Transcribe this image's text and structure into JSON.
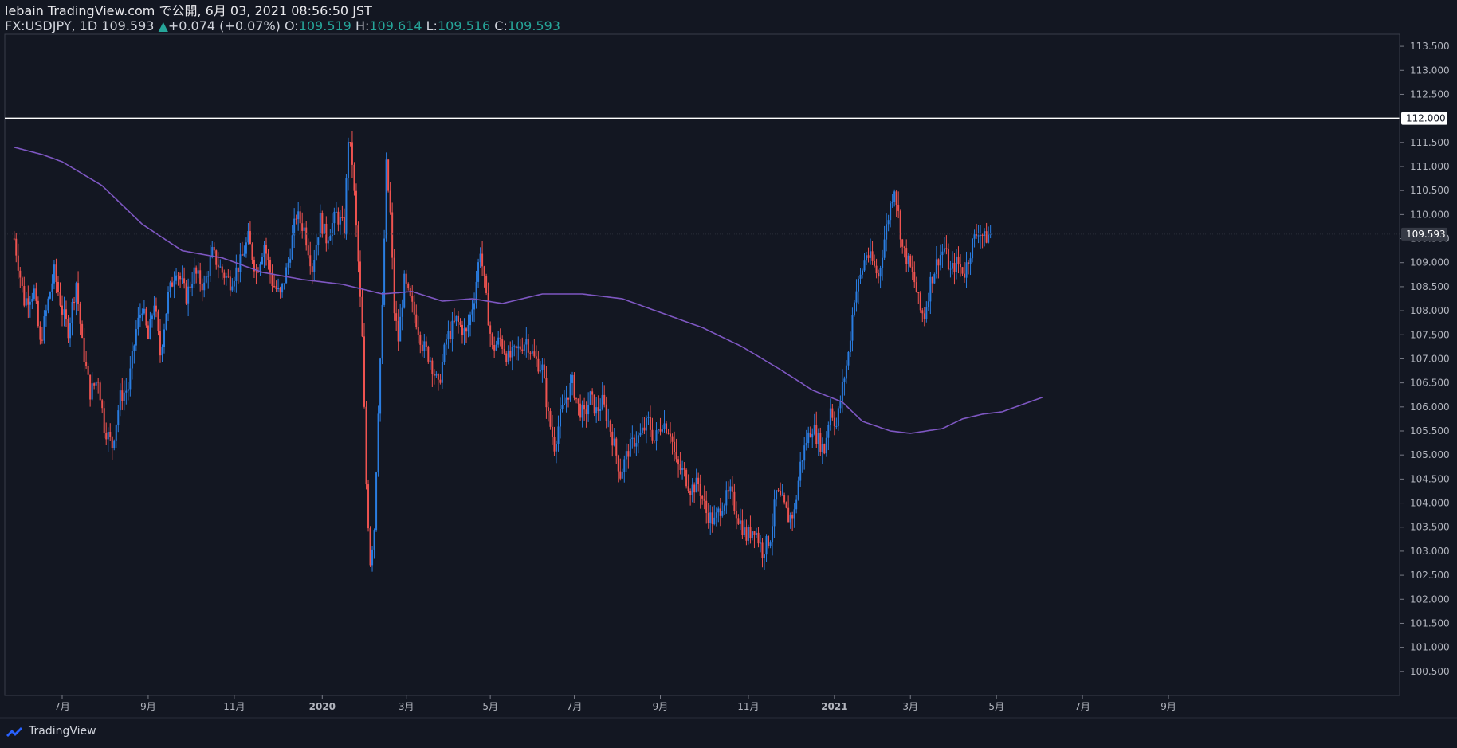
{
  "header": {
    "published_line": "lebain TradingView.com で公開, 6月 03, 2021 08:56:50 JST",
    "symbol": "FX:USDJPY, 1D",
    "last": "109.593",
    "change_arrow": "▲",
    "change": "+0.074 (+0.07%)",
    "o_label": "O:",
    "o_value": "109.519",
    "h_label": "H:",
    "h_value": "109.614",
    "l_label": "L:",
    "l_value": "109.516",
    "c_label": "C:",
    "c_value": "109.593"
  },
  "footer": {
    "brand": "TradingView"
  },
  "colors": {
    "background": "#131722",
    "up": "#2a7de1",
    "down": "#ef5350",
    "ma": "#7e57c2",
    "level": "#ffffff",
    "text": "#d1d4dc"
  },
  "chart_data": {
    "type": "candlestick",
    "ylim": [
      100.0,
      113.75
    ],
    "y_ticks": [
      "100.500",
      "101.000",
      "101.500",
      "102.000",
      "102.500",
      "103.000",
      "103.500",
      "104.000",
      "104.500",
      "105.000",
      "105.500",
      "106.000",
      "106.500",
      "107.000",
      "107.500",
      "108.000",
      "108.500",
      "109.000",
      "109.500",
      "110.000",
      "110.500",
      "111.000",
      "111.500",
      "112.000",
      "112.500",
      "113.000",
      "113.500"
    ],
    "x_ticks": [
      {
        "label": "7月",
        "i": 0
      },
      {
        "label": "9月",
        "i": 43
      },
      {
        "label": "11月",
        "i": 86
      },
      {
        "label": "2020",
        "i": 130
      },
      {
        "label": "3月",
        "i": 172
      },
      {
        "label": "5月",
        "i": 214
      },
      {
        "label": "7月",
        "i": 256
      },
      {
        "label": "9月",
        "i": 299
      },
      {
        "label": "11月",
        "i": 343
      },
      {
        "label": "2021",
        "i": 386
      },
      {
        "label": "3月",
        "i": 424
      },
      {
        "label": "5月",
        "i": 467
      },
      {
        "label": "7月",
        "i": 510
      },
      {
        "label": "9月",
        "i": 553
      }
    ],
    "horizontal_level": {
      "value": 112.0,
      "label": "112.000"
    },
    "last_price": {
      "value": 109.593,
      "label": "109.593"
    },
    "moving_average_anchors": [
      [
        -24,
        111.4
      ],
      [
        -10,
        111.25
      ],
      [
        0,
        111.1
      ],
      [
        20,
        110.6
      ],
      [
        40,
        109.8
      ],
      [
        60,
        109.25
      ],
      [
        80,
        109.1
      ],
      [
        100,
        108.8
      ],
      [
        120,
        108.65
      ],
      [
        140,
        108.55
      ],
      [
        160,
        108.35
      ],
      [
        175,
        108.4
      ],
      [
        190,
        108.2
      ],
      [
        205,
        108.25
      ],
      [
        220,
        108.15
      ],
      [
        240,
        108.35
      ],
      [
        260,
        108.35
      ],
      [
        280,
        108.25
      ],
      [
        300,
        107.95
      ],
      [
        320,
        107.65
      ],
      [
        340,
        107.25
      ],
      [
        360,
        106.75
      ],
      [
        375,
        106.35
      ],
      [
        390,
        106.1
      ],
      [
        400,
        105.7
      ],
      [
        414,
        105.5
      ],
      [
        424,
        105.45
      ],
      [
        440,
        105.55
      ],
      [
        450,
        105.75
      ],
      [
        460,
        105.85
      ],
      [
        470,
        105.9
      ],
      [
        480,
        106.05
      ],
      [
        490,
        106.2
      ]
    ],
    "close_anchors": [
      [
        -24,
        109.5
      ],
      [
        -19,
        108.2
      ],
      [
        -14,
        108.4
      ],
      [
        -11,
        107.3
      ],
      [
        -7,
        108.2
      ],
      [
        -4,
        108.8
      ],
      [
        0,
        108.0
      ],
      [
        3,
        107.6
      ],
      [
        7,
        108.6
      ],
      [
        10,
        107.3
      ],
      [
        14,
        106.3
      ],
      [
        18,
        106.6
      ],
      [
        21,
        105.6
      ],
      [
        25,
        105.2
      ],
      [
        29,
        106.2
      ],
      [
        33,
        106.4
      ],
      [
        37,
        107.6
      ],
      [
        40,
        108.1
      ],
      [
        43,
        107.4
      ],
      [
        46,
        108.2
      ],
      [
        49,
        107.1
      ],
      [
        53,
        108.3
      ],
      [
        57,
        108.9
      ],
      [
        62,
        108.3
      ],
      [
        66,
        108.8
      ],
      [
        71,
        108.5
      ],
      [
        75,
        109.2
      ],
      [
        80,
        108.8
      ],
      [
        84,
        108.6
      ],
      [
        89,
        109.0
      ],
      [
        93,
        109.5
      ],
      [
        97,
        108.8
      ],
      [
        101,
        109.4
      ],
      [
        105,
        108.6
      ],
      [
        109,
        108.3
      ],
      [
        113,
        109.0
      ],
      [
        117,
        110.0
      ],
      [
        121,
        109.7
      ],
      [
        125,
        108.9
      ],
      [
        129,
        109.9
      ],
      [
        132,
        109.5
      ],
      [
        137,
        110.0
      ],
      [
        141,
        109.7
      ],
      [
        143,
        111.6
      ],
      [
        145,
        111.1
      ],
      [
        148,
        109.0
      ],
      [
        150,
        107.4
      ],
      [
        152,
        104.4
      ],
      [
        154,
        102.8
      ],
      [
        156,
        103.5
      ],
      [
        158,
        106.0
      ],
      [
        160,
        108.0
      ],
      [
        162,
        111.0
      ],
      [
        164,
        110.0
      ],
      [
        166,
        108.0
      ],
      [
        168,
        107.4
      ],
      [
        171,
        108.6
      ],
      [
        174,
        108.2
      ],
      [
        177,
        107.8
      ],
      [
        180,
        107.3
      ],
      [
        184,
        107.0
      ],
      [
        188,
        106.4
      ],
      [
        192,
        107.4
      ],
      [
        197,
        107.8
      ],
      [
        202,
        107.5
      ],
      [
        206,
        108.3
      ],
      [
        209,
        109.3
      ],
      [
        212,
        108.2
      ],
      [
        215,
        107.2
      ],
      [
        219,
        107.4
      ],
      [
        223,
        107.0
      ],
      [
        228,
        107.2
      ],
      [
        232,
        107.4
      ],
      [
        236,
        107.0
      ],
      [
        240,
        106.8
      ],
      [
        243,
        105.8
      ],
      [
        246,
        105.2
      ],
      [
        249,
        105.8
      ],
      [
        252,
        106.2
      ],
      [
        255,
        106.5
      ],
      [
        258,
        106.0
      ],
      [
        261,
        105.8
      ],
      [
        264,
        106.2
      ],
      [
        267,
        105.9
      ],
      [
        270,
        106.1
      ],
      [
        273,
        105.7
      ],
      [
        276,
        105.2
      ],
      [
        279,
        104.6
      ],
      [
        283,
        105.1
      ],
      [
        286,
        105.3
      ],
      [
        289,
        105.4
      ],
      [
        293,
        105.7
      ],
      [
        296,
        105.3
      ],
      [
        300,
        105.7
      ],
      [
        304,
        105.5
      ],
      [
        307,
        104.8
      ],
      [
        311,
        104.6
      ],
      [
        314,
        104.3
      ],
      [
        318,
        104.4
      ],
      [
        322,
        103.8
      ],
      [
        326,
        103.6
      ],
      [
        330,
        104.0
      ],
      [
        334,
        104.2
      ],
      [
        338,
        103.7
      ],
      [
        342,
        103.3
      ],
      [
        346,
        103.5
      ],
      [
        350,
        103.0
      ],
      [
        354,
        103.3
      ],
      [
        357,
        104.2
      ],
      [
        360,
        104.0
      ],
      [
        363,
        103.7
      ],
      [
        366,
        103.8
      ],
      [
        369,
        104.8
      ],
      [
        372,
        105.3
      ],
      [
        375,
        105.6
      ],
      [
        378,
        105.3
      ],
      [
        381,
        105.1
      ],
      [
        384,
        106.0
      ],
      [
        387,
        105.6
      ],
      [
        390,
        106.4
      ],
      [
        393,
        107.1
      ],
      [
        396,
        108.3
      ],
      [
        399,
        108.7
      ],
      [
        402,
        109.2
      ],
      [
        405,
        109.0
      ],
      [
        408,
        108.7
      ],
      [
        411,
        109.5
      ],
      [
        414,
        110.2
      ],
      [
        416,
        110.6
      ],
      [
        418,
        110.0
      ],
      [
        420,
        109.3
      ],
      [
        423,
        109.0
      ],
      [
        426,
        108.6
      ],
      [
        429,
        108.0
      ],
      [
        431,
        107.9
      ],
      [
        434,
        108.6
      ],
      [
        438,
        109.1
      ],
      [
        441,
        109.3
      ],
      [
        444,
        108.8
      ],
      [
        447,
        109.0
      ],
      [
        451,
        108.8
      ],
      [
        455,
        109.4
      ],
      [
        458,
        109.7
      ],
      [
        461,
        109.5
      ],
      [
        464,
        109.6
      ]
    ]
  }
}
